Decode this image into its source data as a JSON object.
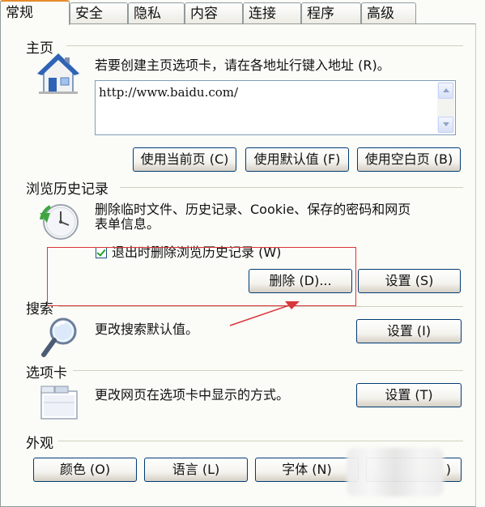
{
  "tabs": [
    "常规",
    "安全",
    "隐私",
    "内容",
    "连接",
    "程序",
    "高级"
  ],
  "home": {
    "header": "主页",
    "description": "若要创建主页选项卡，请在各地址行键入地址 (R)。",
    "url": "http://www.baidu.com/",
    "btn_current": "使用当前页 (C)",
    "btn_default": "使用默认值 (F)",
    "btn_blank": "使用空白页 (B)"
  },
  "history": {
    "header": "浏览历史记录",
    "description_line1": "删除临时文件、历史记录、Cookie、保存的密码和网页",
    "description_line2": "表单信息。",
    "checkbox_label": "退出时删除浏览历史记录 (W)",
    "checkbox_checked": true,
    "btn_delete": "删除 (D)...",
    "btn_settings": "设置 (S)"
  },
  "search": {
    "header": "搜索",
    "description": "更改搜索默认值。",
    "btn_settings": "设置 (I)"
  },
  "tabs_section": {
    "header": "选项卡",
    "description": "更改网页在选项卡中显示的方式。",
    "btn_settings": "设置 (T)"
  },
  "appearance": {
    "header": "外观",
    "btn_colors": "颜色 (O)",
    "btn_languages": "语言 (L)",
    "btn_fonts": "字体 (N)",
    "btn_accessibility_partial": ")"
  },
  "annotation_color": "#d8373c"
}
